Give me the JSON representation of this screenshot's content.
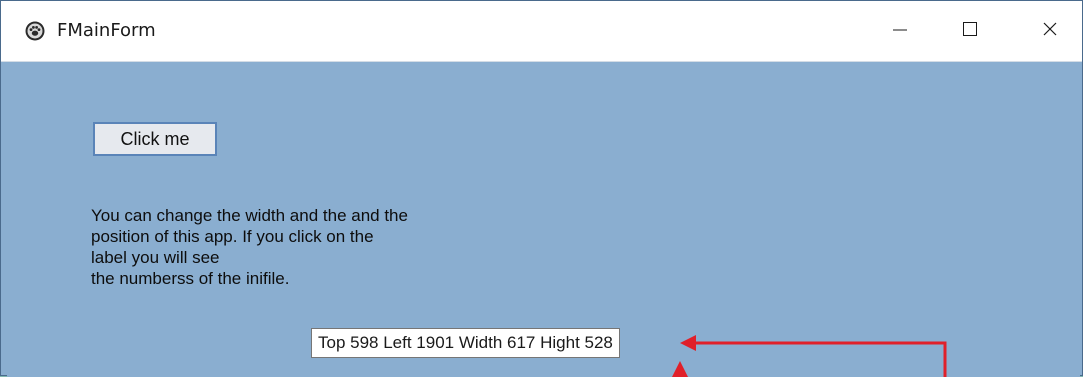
{
  "window": {
    "title": "FMainForm",
    "icon": "paw-icon",
    "controls": {
      "minimize_icon": "minimize-icon",
      "maximize_icon": "maximize-icon",
      "close_icon": "close-icon"
    }
  },
  "form": {
    "button_label": "Click me",
    "label_text": "You can change the width and the and the\nposition of this app. If you click on the\nlabel you will see\nthe numberss of the inifile.",
    "tooltip_text": "Top 598 Left 1901 Width 617 Hight 528"
  },
  "colors": {
    "form_background": "#8aaed0",
    "titlebar": "#ffffff",
    "annotation_arrow": "#e0202a",
    "desktop": "#7fb7b0"
  }
}
